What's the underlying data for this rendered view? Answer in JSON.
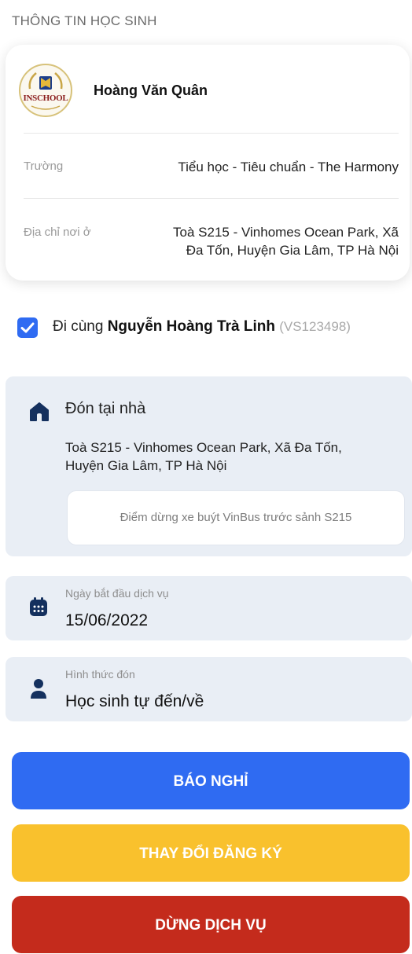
{
  "section_title": "THÔNG TIN HỌC SINH",
  "student": {
    "school_logo_text": "INSCHOOL",
    "name": "Hoàng Văn Quân",
    "school_label": "Trường",
    "school_value": "Tiểu học - Tiêu chuẩn - The Harmony",
    "address_label": "Địa chỉ nơi ở",
    "address_line1": "Toà S215 - Vinhomes Ocean Park, Xã",
    "address_line2": "Đa Tốn, Huyện Gia Lâm, TP Hà Nội"
  },
  "companion": {
    "checked": true,
    "prefix": "Đi cùng ",
    "name": "Nguyễn Hoàng Trà Linh",
    "code": "(VS123498)"
  },
  "pickup": {
    "icon": "home-icon",
    "title": "Đón tại nhà",
    "address_line1": "Toà S215 - Vinhomes Ocean Park, Xã Đa Tốn,",
    "address_line2": "Huyện Gia Lâm, TP Hà Nội",
    "stop_note": "Điểm dừng xe buýt VinBus trước sảnh S215"
  },
  "start_date": {
    "icon": "calendar-icon",
    "label": "Ngày bắt đầu dịch vụ",
    "value": "15/06/2022"
  },
  "pickup_method": {
    "icon": "person-icon",
    "label": "Hình thức đón",
    "value": "Học sinh tự đến/về"
  },
  "buttons": {
    "report_absence": "BÁO NGHỈ",
    "change_registration": "THAY ĐỔI ĐĂNG KÝ",
    "stop_service": "DỪNG DỊCH VỤ"
  },
  "colors": {
    "primary_blue": "#2f6bf2",
    "warning_yellow": "#f9c12d",
    "danger_red": "#c42b1c",
    "panel_bg": "#e9eef5",
    "icon_navy": "#14305e"
  }
}
